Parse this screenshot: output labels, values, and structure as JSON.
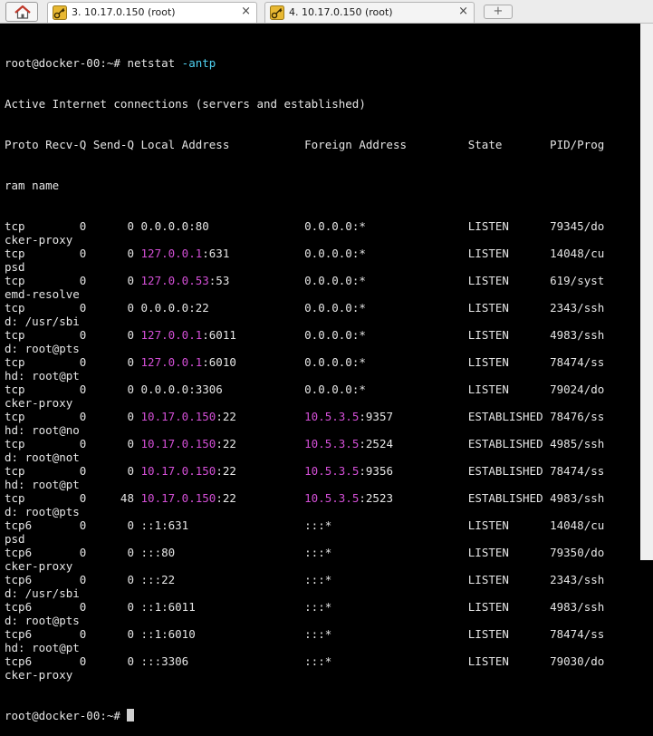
{
  "tabs": [
    {
      "label": "3. 10.17.0.150 (root)",
      "active": true,
      "close": "×"
    },
    {
      "label": "4. 10.17.0.150 (root)",
      "active": false,
      "close": "×"
    }
  ],
  "new_tab": "+",
  "terminal": {
    "command_line": {
      "prompt": "root@docker-00:~# ",
      "cmd": "netstat",
      "args": " -antp"
    },
    "heading": "Active Internet connections (servers and established)",
    "columns": "Proto Recv-Q Send-Q Local Address           Foreign Address         State       PID/Prog",
    "columns_wrap": "ram name",
    "rows": [
      {
        "pre": "tcp        0      0 ",
        "lip": "",
        "lrest": "0.0.0.0:80",
        "lpad": "              ",
        "fip": "",
        "frest": "0.0.0.0:*",
        "fpad": "               ",
        "tail": "LISTEN      79345/do",
        "wrap": "cker-proxy"
      },
      {
        "pre": "tcp        0      0 ",
        "lip": "127.0.0.1",
        "lrest": ":631",
        "lpad": "           ",
        "fip": "",
        "frest": "0.0.0.0:*",
        "fpad": "               ",
        "tail": "LISTEN      14048/cu",
        "wrap": "psd"
      },
      {
        "pre": "tcp        0      0 ",
        "lip": "127.0.0.53",
        "lrest": ":53",
        "lpad": "           ",
        "fip": "",
        "frest": "0.0.0.0:*",
        "fpad": "               ",
        "tail": "LISTEN      619/syst",
        "wrap": "emd-resolve"
      },
      {
        "pre": "tcp        0      0 ",
        "lip": "",
        "lrest": "0.0.0.0:22",
        "lpad": "              ",
        "fip": "",
        "frest": "0.0.0.0:*",
        "fpad": "               ",
        "tail": "LISTEN      2343/ssh",
        "wrap": "d: /usr/sbi"
      },
      {
        "pre": "tcp        0      0 ",
        "lip": "127.0.0.1",
        "lrest": ":6011",
        "lpad": "          ",
        "fip": "",
        "frest": "0.0.0.0:*",
        "fpad": "               ",
        "tail": "LISTEN      4983/ssh",
        "wrap": "d: root@pts"
      },
      {
        "pre": "tcp        0      0 ",
        "lip": "127.0.0.1",
        "lrest": ":6010",
        "lpad": "          ",
        "fip": "",
        "frest": "0.0.0.0:*",
        "fpad": "               ",
        "tail": "LISTEN      78474/ss",
        "wrap": "hd: root@pt"
      },
      {
        "pre": "tcp        0      0 ",
        "lip": "",
        "lrest": "0.0.0.0:3306",
        "lpad": "            ",
        "fip": "",
        "frest": "0.0.0.0:*",
        "fpad": "               ",
        "tail": "LISTEN      79024/do",
        "wrap": "cker-proxy"
      },
      {
        "pre": "tcp        0      0 ",
        "lip": "10.17.0.150",
        "lrest": ":22",
        "lpad": "          ",
        "fip": "10.5.3.5",
        "frest": ":9357",
        "fpad": "           ",
        "tail": "ESTABLISHED 78476/ss",
        "wrap": "hd: root@no"
      },
      {
        "pre": "tcp        0      0 ",
        "lip": "10.17.0.150",
        "lrest": ":22",
        "lpad": "          ",
        "fip": "10.5.3.5",
        "frest": ":2524",
        "fpad": "           ",
        "tail": "ESTABLISHED 4985/ssh",
        "wrap": "d: root@not"
      },
      {
        "pre": "tcp        0      0 ",
        "lip": "10.17.0.150",
        "lrest": ":22",
        "lpad": "          ",
        "fip": "10.5.3.5",
        "frest": ":9356",
        "fpad": "           ",
        "tail": "ESTABLISHED 78474/ss",
        "wrap": "hd: root@pt"
      },
      {
        "pre": "tcp        0     48 ",
        "lip": "10.17.0.150",
        "lrest": ":22",
        "lpad": "          ",
        "fip": "10.5.3.5",
        "frest": ":2523",
        "fpad": "           ",
        "tail": "ESTABLISHED 4983/ssh",
        "wrap": "d: root@pts"
      },
      {
        "pre": "tcp6       0      0 ",
        "lip": "",
        "lrest": "::1:631",
        "lpad": "                 ",
        "fip": "",
        "frest": ":::*",
        "fpad": "                    ",
        "tail": "LISTEN      14048/cu",
        "wrap": "psd"
      },
      {
        "pre": "tcp6       0      0 ",
        "lip": "",
        "lrest": ":::80",
        "lpad": "                   ",
        "fip": "",
        "frest": ":::*",
        "fpad": "                    ",
        "tail": "LISTEN      79350/do",
        "wrap": "cker-proxy"
      },
      {
        "pre": "tcp6       0      0 ",
        "lip": "",
        "lrest": ":::22",
        "lpad": "                   ",
        "fip": "",
        "frest": ":::*",
        "fpad": "                    ",
        "tail": "LISTEN      2343/ssh",
        "wrap": "d: /usr/sbi"
      },
      {
        "pre": "tcp6       0      0 ",
        "lip": "",
        "lrest": "::1:6011",
        "lpad": "                ",
        "fip": "",
        "frest": ":::*",
        "fpad": "                    ",
        "tail": "LISTEN      4983/ssh",
        "wrap": "d: root@pts"
      },
      {
        "pre": "tcp6       0      0 ",
        "lip": "",
        "lrest": "::1:6010",
        "lpad": "                ",
        "fip": "",
        "frest": ":::*",
        "fpad": "                    ",
        "tail": "LISTEN      78474/ss",
        "wrap": "hd: root@pt"
      },
      {
        "pre": "tcp6       0      0 ",
        "lip": "",
        "lrest": ":::3306",
        "lpad": "                 ",
        "fip": "",
        "frest": ":::*",
        "fpad": "                    ",
        "tail": "LISTEN      79030/do",
        "wrap": "cker-proxy"
      }
    ],
    "final_prompt": "root@docker-00:~# "
  },
  "colors": {
    "ip_highlight": "#d34fd6",
    "command_arg": "#4fd2f2",
    "background": "#000000",
    "text": "#e5e5e5"
  }
}
